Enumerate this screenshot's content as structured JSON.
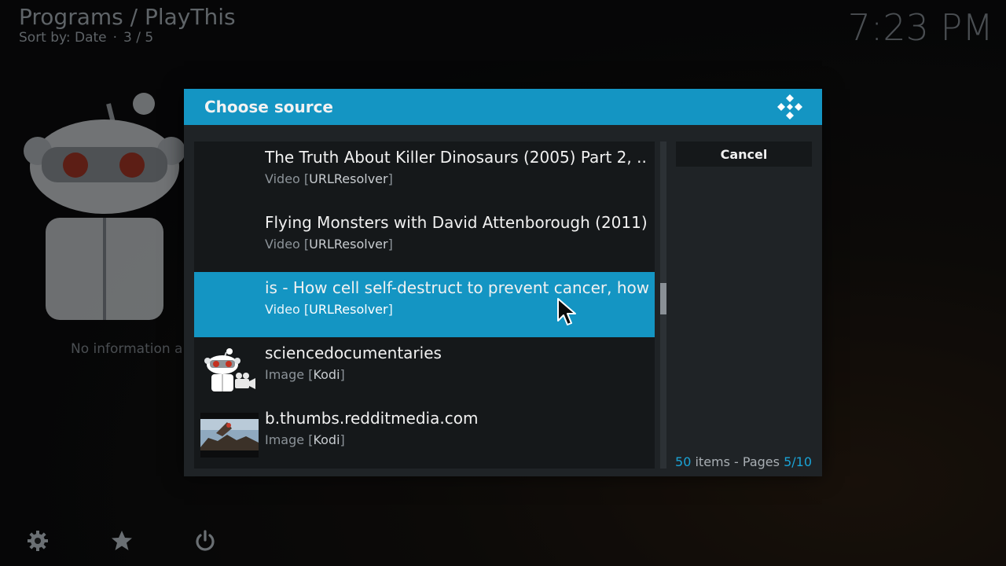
{
  "header": {
    "breadcrumb": "Programs / PlayThis",
    "sort_label": "Sort by: Date",
    "separator": "·",
    "position": "3 / 5",
    "clock": "7:23 PM"
  },
  "background": {
    "no_info": "No information a"
  },
  "dialog": {
    "title": "Choose source",
    "cancel_label": "Cancel",
    "items": [
      {
        "title": "The Truth About Killer Dinosaurs (2005) Part 2, ...",
        "type": "Video",
        "source": "URLResolver",
        "thumb": "none"
      },
      {
        "title": "Flying Monsters with David Attenborough (2011)",
        "type": "Video",
        "source": "URLResolver",
        "thumb": "none"
      },
      {
        "title": "is - How cell self-destruct to prevent cancer, how cl",
        "type": "Video",
        "source": "URLResolver",
        "thumb": "none",
        "selected": true
      },
      {
        "title": "sciencedocumentaries",
        "type": "Image",
        "source": "Kodi",
        "thumb": "reddit-mascot-icon"
      },
      {
        "title": "b.thumbs.redditmedia.com",
        "type": "Image",
        "source": "Kodi",
        "thumb": "landscape-thumbnail"
      }
    ],
    "footer": {
      "count": "50",
      "items_label": "items - Pages",
      "pages": "5/10"
    },
    "scroll_fraction": 0.5
  },
  "colors": {
    "accent": "#1495c3",
    "dialog_bg": "#1f2326",
    "list_bg": "#15181a"
  },
  "bottom_icons": [
    "settings-gear-icon",
    "favourites-star-icon",
    "power-icon"
  ]
}
